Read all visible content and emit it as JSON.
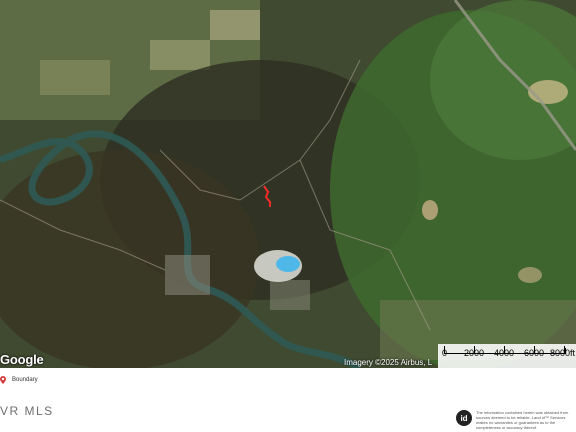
{
  "map": {
    "logo": "Google",
    "attribution": "Imagery ©2025 Airbus, L",
    "scale_labels": [
      "0",
      "2000",
      "4000",
      "6000",
      "8000ft"
    ],
    "boundary_color": "#ff2a2a",
    "water_color": "#4fb8e8"
  },
  "legend": {
    "label": "Boundary",
    "icon": "boundary-marker-icon"
  },
  "footer": {
    "source": "VR MLS",
    "badge": "id",
    "disclaimer": "The information contained herein was obtained from sources deemed to be reliable. Land id™ Services makes no warranties or guarantees as to the completeness or accuracy thereof."
  }
}
